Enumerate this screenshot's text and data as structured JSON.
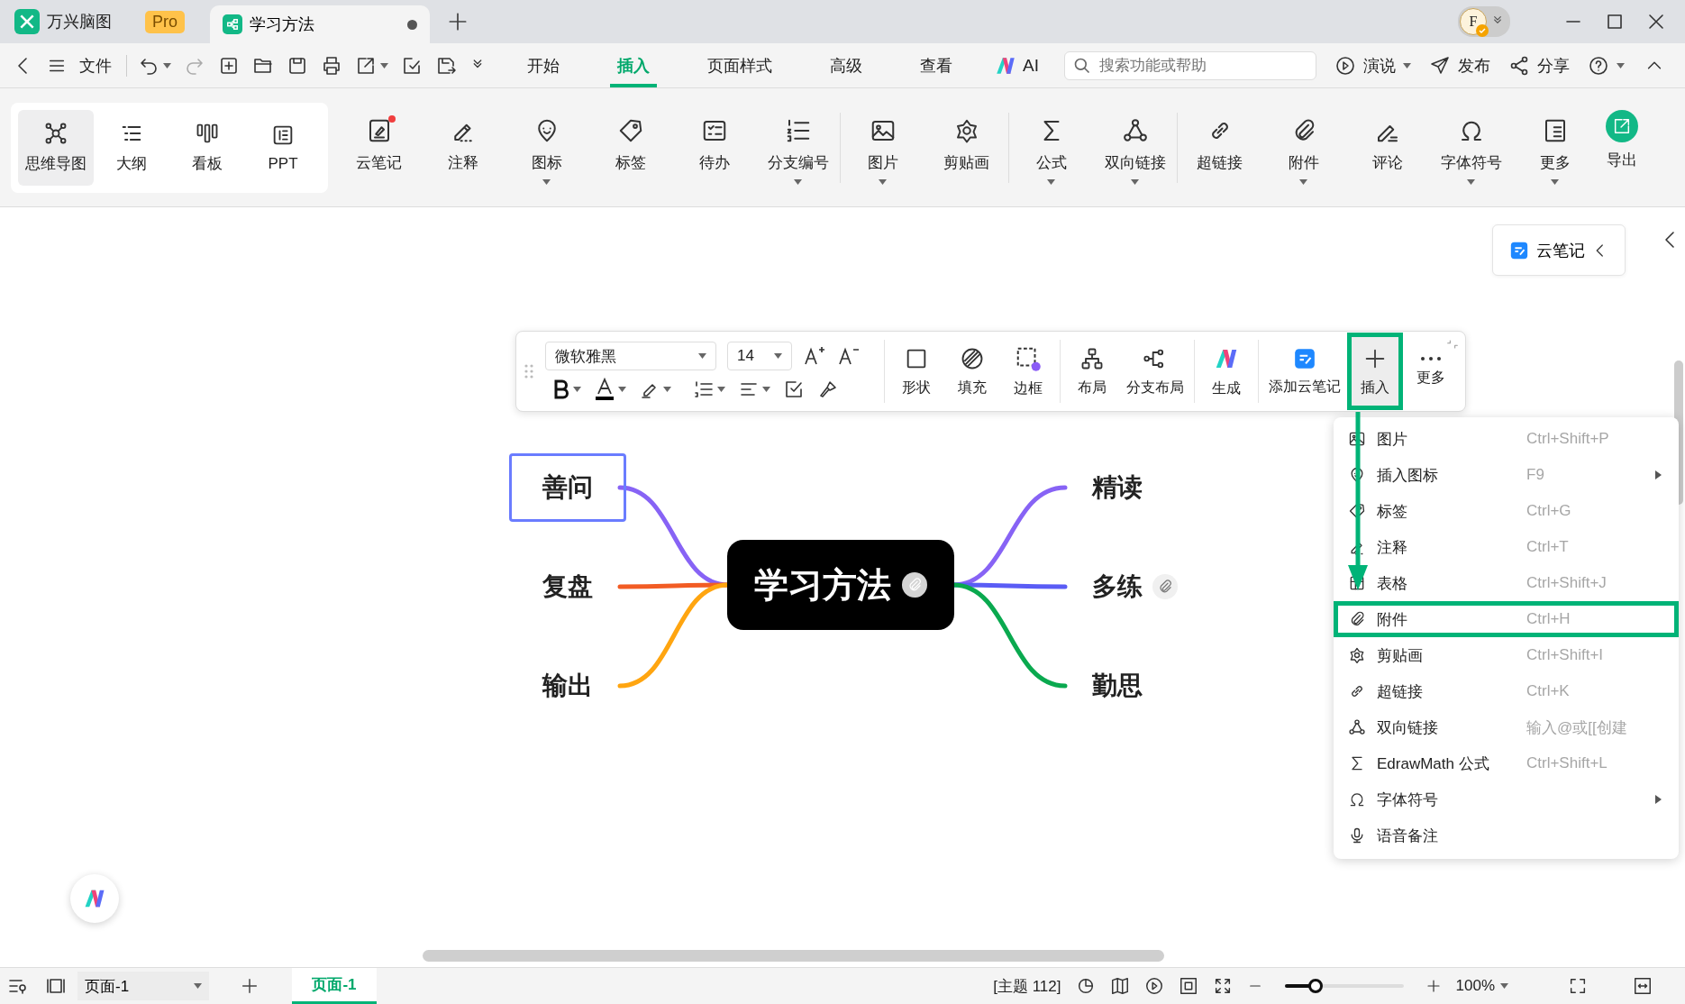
{
  "title_bar": {
    "app_name": "万兴脑图",
    "badge": "Pro",
    "tabs": [
      {
        "label": "学习方法",
        "selected": true,
        "modified": true
      }
    ],
    "avatar_letter": "F"
  },
  "menu_bar": {
    "file": "文件",
    "tabs": [
      {
        "label": "开始",
        "selected": false
      },
      {
        "label": "插入",
        "selected": true
      },
      {
        "label": "页面样式",
        "selected": false
      },
      {
        "label": "高级",
        "selected": false
      },
      {
        "label": "查看",
        "selected": false
      }
    ],
    "ai": "AI",
    "search": {
      "placeholder": "搜索功能或帮助"
    },
    "actions": [
      {
        "label": "演说",
        "dropdown": true
      },
      {
        "label": "发布",
        "dropdown": false
      },
      {
        "label": "分享",
        "dropdown": false
      }
    ]
  },
  "ribbon": {
    "views": [
      {
        "label": "思维导图",
        "selected": true
      },
      {
        "label": "大纲",
        "selected": false
      },
      {
        "label": "看板",
        "selected": false
      },
      {
        "label": "PPT",
        "selected": false
      }
    ],
    "tool_groups": [
      {
        "tools": [
          {
            "label": "云笔记",
            "notification": true,
            "dropdown": false
          },
          {
            "label": "注释",
            "notification": false,
            "dropdown": false
          },
          {
            "label": "图标",
            "notification": false,
            "dropdown": true
          },
          {
            "label": "标签",
            "notification": false,
            "dropdown": false
          },
          {
            "label": "待办",
            "notification": false,
            "dropdown": false
          },
          {
            "label": "分支编号",
            "notification": false,
            "dropdown": true
          }
        ]
      },
      {
        "tools": [
          {
            "label": "图片",
            "notification": false,
            "dropdown": true
          },
          {
            "label": "剪贴画",
            "notification": false,
            "dropdown": false
          }
        ]
      },
      {
        "tools": [
          {
            "label": "公式",
            "notification": false,
            "dropdown": true
          },
          {
            "label": "双向链接",
            "notification": false,
            "dropdown": true
          }
        ]
      },
      {
        "tools": [
          {
            "label": "超链接",
            "notification": false,
            "dropdown": false
          },
          {
            "label": "附件",
            "notification": false,
            "dropdown": true
          },
          {
            "label": "评论",
            "notification": false,
            "dropdown": false
          },
          {
            "label": "字体符号",
            "notification": false,
            "dropdown": true
          },
          {
            "label": "更多",
            "notification": false,
            "dropdown": true
          }
        ]
      }
    ],
    "export": "导出"
  },
  "canvas": {
    "cloud_note_button": "云笔记",
    "mind_map": {
      "central": {
        "label": "学习方法",
        "attachment": true
      },
      "left_branches": [
        {
          "label": "善问",
          "color": "#8763f5",
          "selected": true,
          "attachment": false
        },
        {
          "label": "复盘",
          "color": "#f25c24",
          "selected": false,
          "attachment": false
        },
        {
          "label": "输出",
          "color": "#ffa510",
          "selected": false,
          "attachment": false
        }
      ],
      "right_branches": [
        {
          "label": "精读",
          "color": "#8763f5",
          "selected": false,
          "attachment": false
        },
        {
          "label": "多练",
          "color": "#5a5cf5",
          "selected": false,
          "attachment": true
        },
        {
          "label": "勤思",
          "color": "#0aa94f",
          "selected": false,
          "attachment": false
        }
      ]
    },
    "floating_toolbar": {
      "font": "微软雅黑",
      "size": "14",
      "button_groups": [
        [
          {
            "label": "形状",
            "selected": false,
            "highlighted": false
          },
          {
            "label": "填充",
            "selected": false,
            "highlighted": false
          },
          {
            "label": "边框",
            "selected": false,
            "highlighted": false
          }
        ],
        [
          {
            "label": "布局",
            "selected": false,
            "highlighted": false
          },
          {
            "label": "分支布局",
            "selected": false,
            "highlighted": false
          }
        ],
        [
          {
            "label": "生成",
            "selected": false,
            "highlighted": false
          }
        ],
        [
          {
            "label": "添加云笔记",
            "selected": false,
            "highlighted": false
          },
          {
            "label": "插入",
            "selected": true,
            "highlighted": true
          },
          {
            "label": "更多",
            "selected": false,
            "highlighted": false
          }
        ]
      ]
    },
    "insert_menu": {
      "items": [
        {
          "label": "图片",
          "shortcut": "Ctrl+Shift+P",
          "submenu": false,
          "highlighted": false
        },
        {
          "label": "插入图标",
          "shortcut": "F9",
          "submenu": true,
          "highlighted": false
        },
        {
          "label": "标签",
          "shortcut": "Ctrl+G",
          "submenu": false,
          "highlighted": false
        },
        {
          "label": "注释",
          "shortcut": "Ctrl+T",
          "submenu": false,
          "highlighted": false
        },
        {
          "label": "表格",
          "shortcut": "Ctrl+Shift+J",
          "submenu": false,
          "highlighted": false
        },
        {
          "label": "附件",
          "shortcut": "Ctrl+H",
          "submenu": false,
          "highlighted": true
        },
        {
          "label": "剪贴画",
          "shortcut": "Ctrl+Shift+I",
          "submenu": false,
          "highlighted": false
        },
        {
          "label": "超链接",
          "shortcut": "Ctrl+K",
          "submenu": false,
          "highlighted": false
        },
        {
          "label": "双向链接",
          "shortcut": "输入@或[[创建",
          "submenu": false,
          "highlighted": false
        },
        {
          "label": "EdrawMath 公式",
          "shortcut": "Ctrl+Shift+L",
          "submenu": false,
          "highlighted": false
        },
        {
          "label": "字体符号",
          "submenu": true,
          "highlighted": false
        },
        {
          "label": "语音备注",
          "submenu": false,
          "highlighted": false
        }
      ]
    }
  },
  "status_bar": {
    "page_select": "页面-1",
    "page_tabs": [
      {
        "label": "页面-1",
        "selected": true
      }
    ],
    "topic_count": "[主题 112]",
    "zoom": {
      "level": 0.26,
      "reading": "100%"
    }
  }
}
